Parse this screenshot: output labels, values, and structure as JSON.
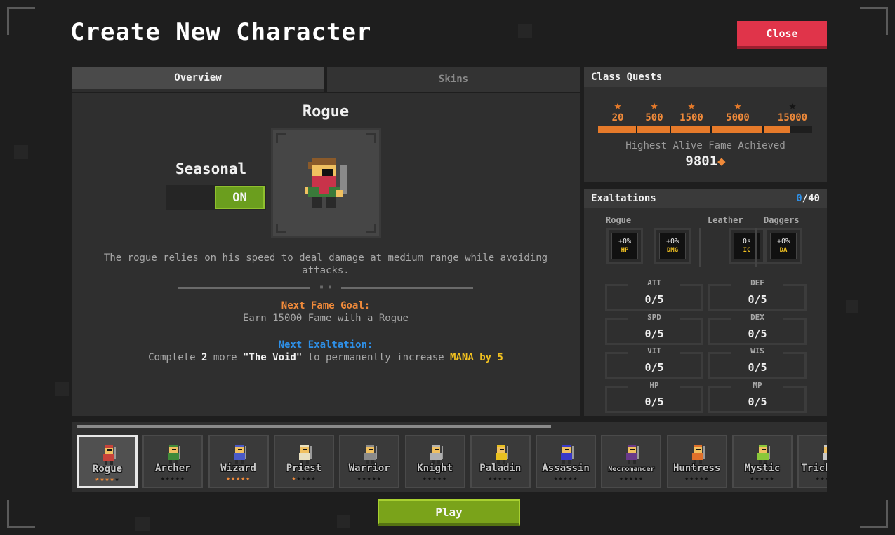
{
  "title": "Create New Character",
  "close_label": "Close",
  "tabs": {
    "overview": "Overview",
    "skins": "Skins"
  },
  "overview": {
    "class_name": "Rogue",
    "seasonal_label": "Seasonal",
    "seasonal_toggle": "ON",
    "description": "The rogue relies on his speed to deal damage at medium range while avoiding attacks.",
    "next_fame_goal_label": "Next Fame Goal:",
    "next_fame_goal_text": "Earn 15000 Fame with a Rogue",
    "next_exaltation_label": "Next Exaltation:",
    "next_exaltation_parts": {
      "pre": "Complete",
      "count": "2",
      "mid": "more",
      "dungeon": "\"The Void\"",
      "post": "to permanently increase",
      "reward": "MANA by 5"
    }
  },
  "class_quests": {
    "header": "Class Quests",
    "milestones": [
      {
        "value": "20",
        "achieved": true
      },
      {
        "value": "500",
        "achieved": true
      },
      {
        "value": "1500",
        "achieved": true
      },
      {
        "value": "5000",
        "achieved": true
      },
      {
        "value": "15000",
        "achieved": false
      }
    ],
    "progress_fraction": 0.9,
    "highest_fame_label": "Highest Alive Fame Achieved",
    "highest_fame_value": "9801"
  },
  "exaltations": {
    "header": "Exaltations",
    "count_current": "0",
    "count_total": "/40",
    "groups": [
      {
        "label": "Rogue",
        "slots": [
          {
            "value": "+0%",
            "tag": "HP"
          },
          {
            "value": "+0%",
            "tag": "DMG"
          }
        ]
      },
      {
        "label": "Leather",
        "slots": [
          {
            "value": "0s",
            "tag": "IC"
          }
        ]
      },
      {
        "label": "Daggers",
        "slots": [
          {
            "value": "+0%",
            "tag": "DA"
          }
        ]
      }
    ],
    "stats": [
      {
        "name": "ATT",
        "value": "0/5"
      },
      {
        "name": "DEF",
        "value": "0/5"
      },
      {
        "name": "SPD",
        "value": "0/5"
      },
      {
        "name": "DEX",
        "value": "0/5"
      },
      {
        "name": "VIT",
        "value": "0/5"
      },
      {
        "name": "WIS",
        "value": "0/5"
      },
      {
        "name": "HP",
        "value": "0/5"
      },
      {
        "name": "MP",
        "value": "0/5"
      }
    ]
  },
  "classes": [
    {
      "name": "Rogue",
      "stars": 4,
      "color": "#c8433a",
      "selected": true
    },
    {
      "name": "Archer",
      "stars": 0,
      "color": "#3f8a3a"
    },
    {
      "name": "Wizard",
      "stars": 5,
      "color": "#4a5ac8"
    },
    {
      "name": "Priest",
      "stars": 1,
      "color": "#e8e0c0"
    },
    {
      "name": "Warrior",
      "stars": 0,
      "color": "#8a8a8a"
    },
    {
      "name": "Knight",
      "stars": 0,
      "color": "#b0b0b0"
    },
    {
      "name": "Paladin",
      "stars": 0,
      "color": "#e8c020"
    },
    {
      "name": "Assassin",
      "stars": 0,
      "color": "#3a3ac8"
    },
    {
      "name": "Necromancer",
      "stars": 0,
      "color": "#6a3a8a"
    },
    {
      "name": "Huntress",
      "stars": 0,
      "color": "#e0702a"
    },
    {
      "name": "Mystic",
      "stars": 0,
      "color": "#8ac83a"
    },
    {
      "name": "Trickster",
      "stars": 0,
      "color": "#c8c8c8"
    }
  ],
  "play_label": "Play",
  "colors": {
    "accent_orange": "#f08a3a",
    "accent_blue": "#2e8fe6",
    "close_red": "#e0344a",
    "play_green": "#7aa31a",
    "highlight_yellow": "#f0c020"
  }
}
